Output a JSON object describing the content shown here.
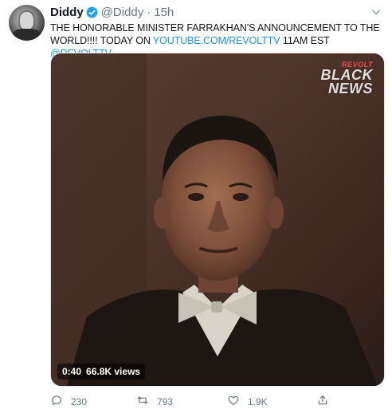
{
  "tweet": {
    "display_name": "Diddy",
    "handle": "@Diddy",
    "separator": "·",
    "time": "15h",
    "text_pre": "THE HONORABLE MINISTER FARRAKHAN'S ANNOUNCEMENT TO THE WORLD!!!! TODAY ON ",
    "link_url": "YOUTUBE.COM/REVOLTTV",
    "text_mid": " 11AM EST ",
    "mention": "@REVOLTTV",
    "video": {
      "watermark_brand": "REVOLT",
      "watermark_line1": "BLACK",
      "watermark_line2": "NEWS",
      "duration": "0:40",
      "views": "66.8K views"
    },
    "actions": {
      "reply_count": "230",
      "retweet_count": "793",
      "like_count": "1.9K"
    }
  },
  "colors": {
    "link": "#1b95e0",
    "secondary_text": "#657786",
    "verified_badge": "#1da1f2"
  },
  "icons": [
    "verified-badge-icon",
    "chevron-down-icon",
    "reply-icon",
    "retweet-icon",
    "like-icon",
    "share-icon"
  ]
}
